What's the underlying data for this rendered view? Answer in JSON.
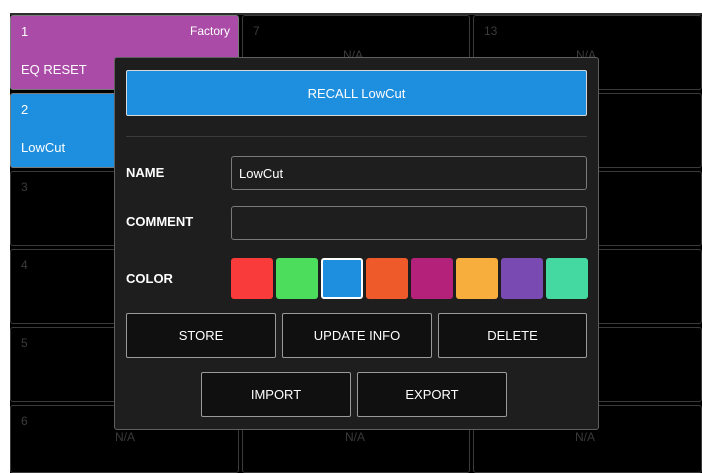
{
  "slots": [
    {
      "num": "1",
      "name": "EQ RESET",
      "source": "Factory",
      "na": ""
    },
    {
      "num": "2",
      "name": "LowCut",
      "source": "",
      "na": ""
    },
    {
      "num": "3",
      "name": "",
      "source": "",
      "na": ""
    },
    {
      "num": "4",
      "name": "",
      "source": "",
      "na": ""
    },
    {
      "num": "5",
      "name": "",
      "source": "",
      "na": ""
    },
    {
      "num": "6",
      "name": "",
      "source": "",
      "na": "N/A"
    },
    {
      "num": "7",
      "name": "",
      "source": "",
      "na": "N/A"
    },
    {
      "num": "",
      "name": "",
      "source": "",
      "na": "N/A"
    },
    {
      "num": "13",
      "name": "",
      "source": "",
      "na": "N/A"
    },
    {
      "num": "",
      "name": "",
      "source": "",
      "na": "N/A"
    }
  ],
  "dialog": {
    "recall_label": "RECALL LowCut",
    "name_label": "NAME",
    "name_value": "LowCut",
    "comment_label": "COMMENT",
    "comment_value": "",
    "color_label": "COLOR",
    "store_label": "STORE",
    "update_label": "UPDATE INFO",
    "delete_label": "DELETE",
    "import_label": "IMPORT",
    "export_label": "EXPORT"
  },
  "colors": {
    "swatches": [
      "#fa3b3b",
      "#4ddd5d",
      "#1e8ede",
      "#ef5a2b",
      "#b3217a",
      "#f8ae3c",
      "#7a4ab3",
      "#45d9a2"
    ],
    "selected_index": 2,
    "slot1_color": "#a94ba7",
    "slot2_color": "#1e8ede"
  }
}
